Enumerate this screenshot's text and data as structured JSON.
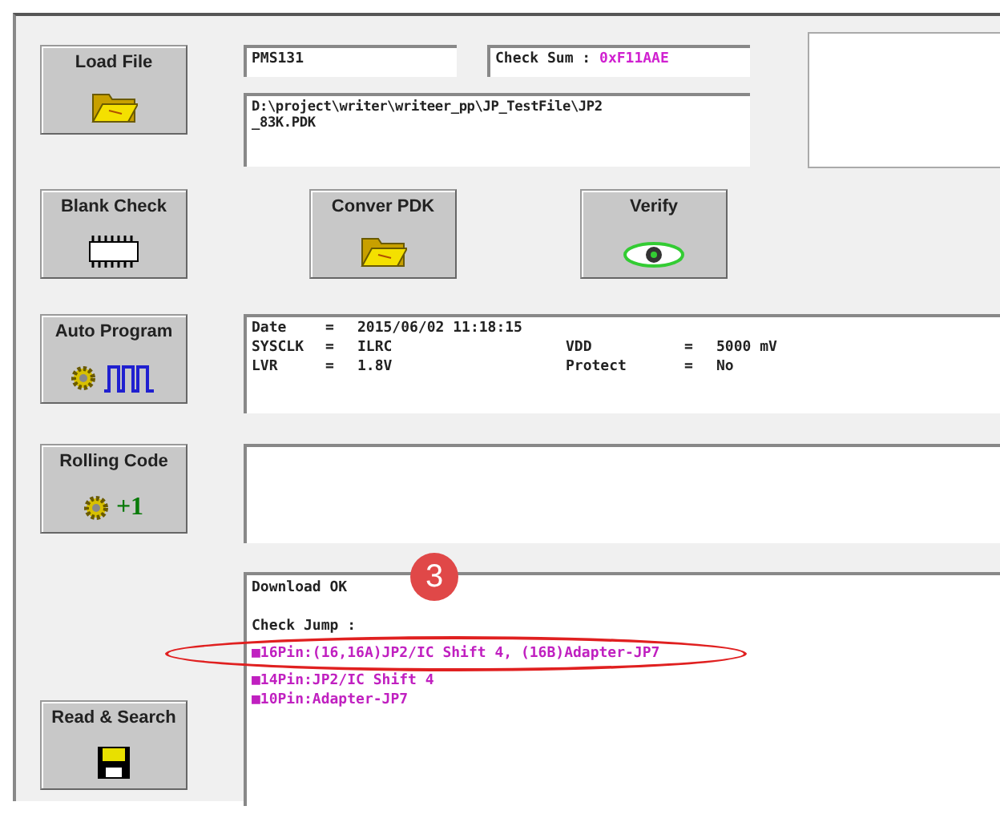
{
  "chip_field": {
    "value": "PMS131"
  },
  "checksum_field": {
    "label": "Check Sum :",
    "value": "0xF11AAE"
  },
  "path_field": {
    "lines": [
      "D:\\project\\writer\\writeer_pp\\JP_TestFile\\JP2",
      "_83K.PDK"
    ]
  },
  "side_buttons": [
    {
      "label": "Load File",
      "kind": "load"
    },
    {
      "label": "Blank Check",
      "kind": "blank"
    },
    {
      "label": "Auto Program",
      "kind": "auto"
    },
    {
      "label": "Rolling Code",
      "kind": "rolling",
      "icon_text": "+1"
    },
    {
      "label": "Read & Search",
      "kind": "read"
    }
  ],
  "middle_buttons": [
    {
      "label": "Conver PDK",
      "kind": "convert"
    },
    {
      "label": "Verify",
      "kind": "verify"
    }
  ],
  "info_rows": [
    [
      {
        "label": "Date",
        "sign": "=",
        "value": "2015/06/02  11:18:15"
      }
    ],
    [
      {
        "label": "SYSCLK",
        "sign": "=",
        "value": "ILRC"
      },
      {
        "label": "VDD",
        "sign": "=",
        "value": "5000 mV"
      }
    ],
    [
      {
        "label": "LVR",
        "sign": "=",
        "value": "1.8V"
      },
      {
        "label": "Protect",
        "sign": "=",
        "value": "No"
      }
    ]
  ],
  "log_lines": [
    {
      "text": "Download OK",
      "kind": "plain"
    },
    {
      "kind": "blank"
    },
    {
      "text": "Check Jump  :",
      "kind": "plain"
    },
    {
      "text": "■16Pin:(16,16A)JP2/IC Shift 4, (16B)Adapter-JP7",
      "kind": "pin",
      "circled": true
    },
    {
      "text": "■14Pin:JP2/IC Shift 4",
      "kind": "pin",
      "circled": false
    },
    {
      "text": "■10Pin:Adapter-JP7",
      "kind": "pin",
      "circled": false
    }
  ],
  "step_badge": {
    "text": "3"
  }
}
